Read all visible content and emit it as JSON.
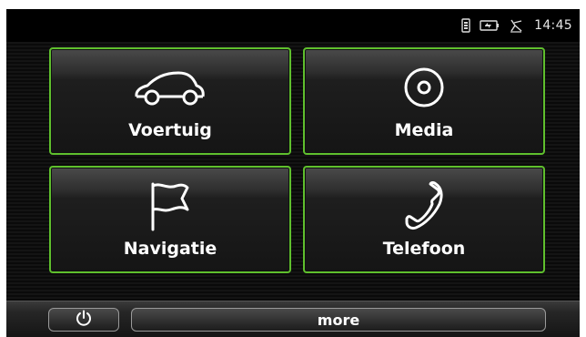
{
  "status": {
    "time": "14:45",
    "icons": [
      "sim-card-icon",
      "battery-icon",
      "gps-satellite-icon"
    ]
  },
  "tiles": [
    {
      "label": "Voertuig",
      "icon": "car-icon"
    },
    {
      "label": "Media",
      "icon": "disc-icon"
    },
    {
      "label": "Navigatie",
      "icon": "flag-icon"
    },
    {
      "label": "Telefoon",
      "icon": "phone-icon"
    }
  ],
  "bottom": {
    "power_icon": "power-icon",
    "more_label": "more"
  },
  "colors": {
    "accent": "#5fbf2d",
    "background": "#0a0a0a",
    "text": "#ffffff"
  }
}
